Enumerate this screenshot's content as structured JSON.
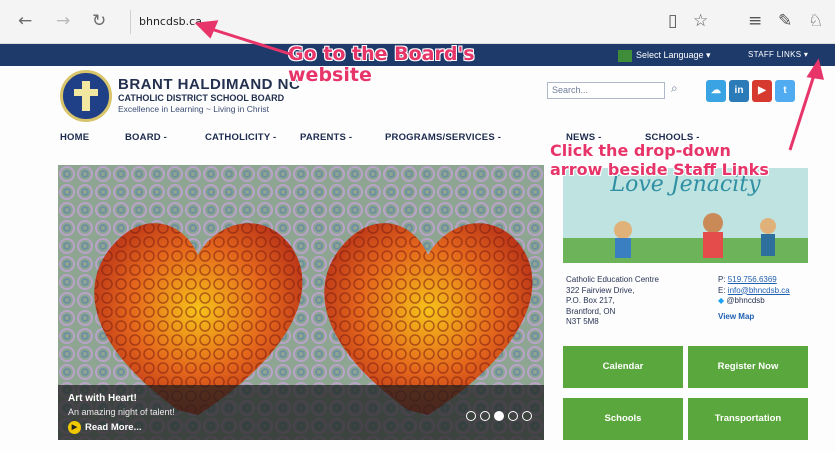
{
  "browser": {
    "url": "bhncdsb.ca",
    "back_icon": "←",
    "forward_icon": "→",
    "reload_icon": "↻",
    "right_icons": [
      "▯",
      "☆",
      "≡",
      "✎",
      "♘"
    ]
  },
  "topbar": {
    "language_label": "Select Language ▾",
    "staff_links_label": "STAFF LINKS ▾"
  },
  "header": {
    "title": "BRANT HALDIMAND NC",
    "subtitle": "CATHOLIC DISTRICT SCHOOL BOARD",
    "tagline": "Excellence in Learning ~ Living in Christ",
    "search_placeholder": "Search...",
    "social_icons": [
      "cloud-icon",
      "linkedin-icon",
      "youtube-icon",
      "twitter-icon"
    ]
  },
  "nav": {
    "items": [
      "HOME",
      "BOARD -",
      "CATHOLICITY -",
      "PARENTS -",
      "PROGRAMS/SERVICES -",
      "NEWS -",
      "SCHOOLS -"
    ]
  },
  "hero": {
    "title": "Art with Heart!",
    "subtitle": "An amazing night of talent!",
    "read_more": "Read More...",
    "slide_count": 5,
    "active_slide": 3
  },
  "promo": {
    "title": "Love Jenacity"
  },
  "contact": {
    "address_lines": [
      "Catholic Education Centre",
      "322 Fairview Drive,",
      "P.O. Box 217,",
      "Brantford, ON",
      "N3T 5M8"
    ],
    "phone_label": "P:",
    "phone": "519.756.6369",
    "email_label": "E:",
    "email": "info@bhncdsb.ca",
    "twitter": "@bhncdsb",
    "view_map": "View Map"
  },
  "tiles": [
    "Calendar",
    "Register Now",
    "Schools",
    "Transportation"
  ],
  "annotations": {
    "first": "Go to the Board's website",
    "first_line1": "Go to the Board's",
    "first_line2": "website",
    "second_line1": "Click the drop-down",
    "second_line2": "arrow beside Staff Links"
  },
  "colors": {
    "topbar": "#1d3a6b",
    "tile_green": "#5aa83d",
    "annotation": "#e7356a"
  }
}
